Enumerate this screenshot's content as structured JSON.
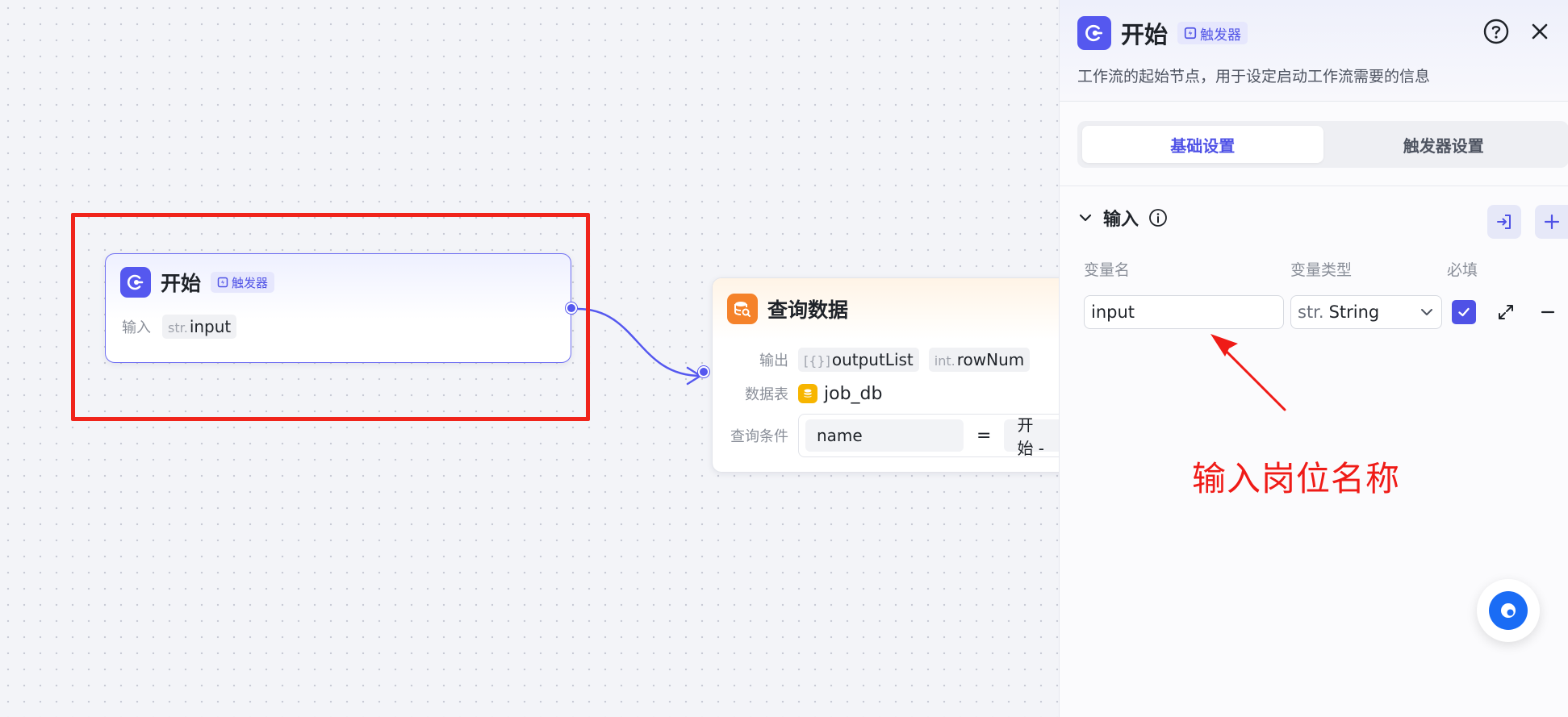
{
  "canvas": {
    "start_node": {
      "title": "开始",
      "badge": "触发器",
      "input_label": "输入",
      "input_type": "str.",
      "input_name": "input"
    },
    "query_node": {
      "title": "查询数据",
      "output_label": "输出",
      "outputs": [
        {
          "type": "[{}]",
          "name": "outputList"
        },
        {
          "type": "int.",
          "name": "rowNum"
        }
      ],
      "table_label": "数据表",
      "table_name": "job_db",
      "condition_label": "查询条件",
      "condition_field": "name",
      "condition_op": "=",
      "condition_ref": "开始 -"
    }
  },
  "panel": {
    "title": "开始",
    "badge": "触发器",
    "description": "工作流的起始节点，用于设定启动工作流需要的信息",
    "tabs": [
      {
        "label": "基础设置",
        "active": true
      },
      {
        "label": "触发器设置",
        "active": false
      }
    ],
    "section_title": "输入",
    "columns": {
      "name": "变量名",
      "type": "变量类型",
      "required": "必填"
    },
    "variable": {
      "name": "input",
      "type_prefix": "str.",
      "type": "String",
      "required": true
    }
  },
  "annotation": {
    "text": "输入岗位名称",
    "color": "#ef1b17"
  },
  "colors": {
    "accent": "#5558ef",
    "query_accent": "#f5822a",
    "highlight": "#f0241b"
  },
  "icons": [
    "start-node-icon",
    "trigger-icon",
    "database-query-icon",
    "database-icon",
    "help-icon",
    "close-icon",
    "chevron-down-icon",
    "info-icon",
    "import-icon",
    "add-icon",
    "check-icon",
    "expand-icon",
    "minus-icon",
    "chat-icon"
  ]
}
